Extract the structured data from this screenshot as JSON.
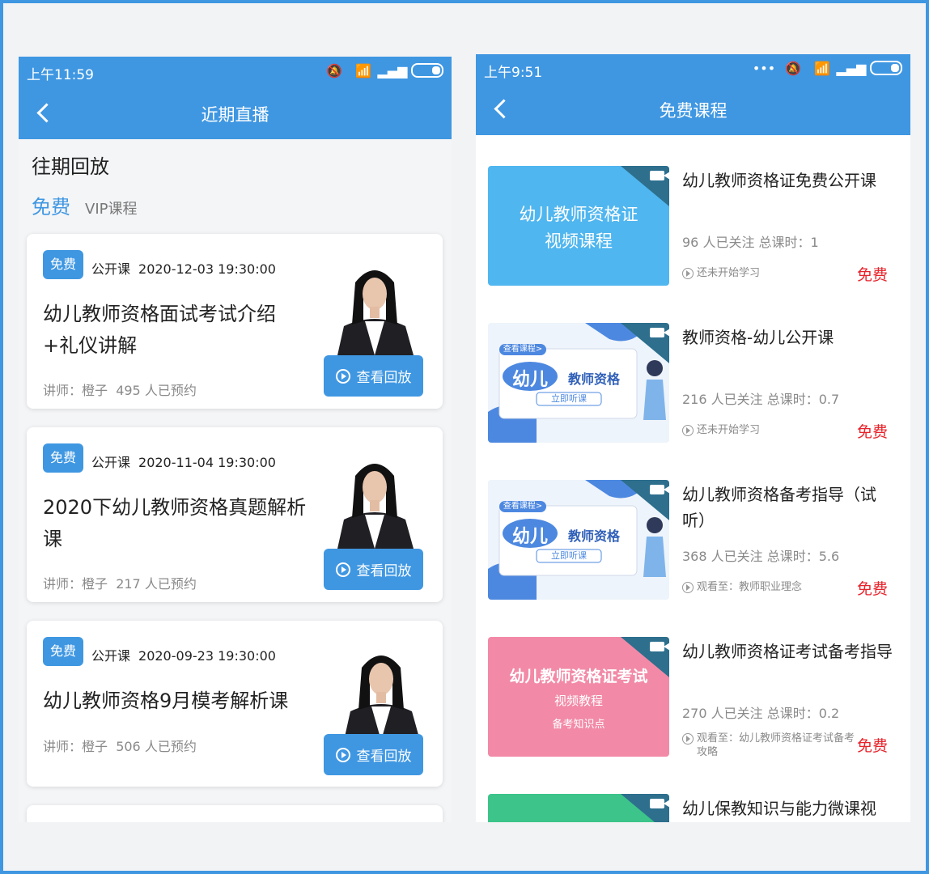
{
  "left": {
    "status": {
      "time": "上午11:59"
    },
    "nav": {
      "title": "近期直播"
    },
    "section_title": "往期回放",
    "tabs": [
      {
        "label": "免费"
      },
      {
        "label": "VIP课程"
      }
    ],
    "cards": [
      {
        "badge": "免费",
        "type": "公开课",
        "datetime": "2020-12-03 19:30:00",
        "title": "幼儿教师资格面试考试介绍+礼仪讲解",
        "lecturer": "讲师：橙子",
        "booked": "495 人已预约",
        "button": "查看回放"
      },
      {
        "badge": "免费",
        "type": "公开课",
        "datetime": "2020-11-04 19:30:00",
        "title": "2020下幼儿教师资格真题解析课",
        "lecturer": "讲师：橙子",
        "booked": "217 人已预约",
        "button": "查看回放"
      },
      {
        "badge": "免费",
        "type": "公开课",
        "datetime": "2020-09-23 19:30:00",
        "title": "幼儿教师资格9月模考解析课",
        "lecturer": "讲师：橙子",
        "booked": "506 人已预约",
        "button": "查看回放"
      }
    ]
  },
  "right": {
    "status": {
      "time": "上午9:51"
    },
    "nav": {
      "title": "免费课程"
    },
    "courses": [
      {
        "title": "幼儿教师资格证免费公开课",
        "stats": "96 人已关注  总课时：1",
        "progress": "还未开始学习",
        "price": "免费",
        "thumb_line1": "幼儿教师资格证",
        "thumb_line2": "视频课程"
      },
      {
        "title": "教师资格-幼儿公开课",
        "stats": "216 人已关注  总课时：0.7",
        "progress": "还未开始学习",
        "price": "免费",
        "thumb_line1": "幼儿",
        "thumb_line2": "教师资格",
        "thumb_btn": "立即听课",
        "thumb_tag": "查看课程>"
      },
      {
        "title": "幼儿教师资格备考指导（试听）",
        "stats": "368 人已关注  总课时：5.6",
        "progress": "观看至：教师职业理念",
        "price": "免费",
        "thumb_line1": "幼儿",
        "thumb_line2": "教师资格",
        "thumb_btn": "立即听课",
        "thumb_tag": "查看课程>"
      },
      {
        "title": "幼儿教师资格证考试备考指导",
        "stats": "270 人已关注  总课时：0.2",
        "progress": "观看至：幼儿教师资格证考试备考攻略",
        "price": "免费",
        "thumb_line1": "幼儿教师资格证考试",
        "thumb_line2": "视频教程",
        "thumb_line3": "备考知识点"
      },
      {
        "title": "幼儿保教知识与能力微课视"
      }
    ]
  },
  "colors": {
    "brand": "#3f97e2",
    "price": "#e8232b"
  }
}
